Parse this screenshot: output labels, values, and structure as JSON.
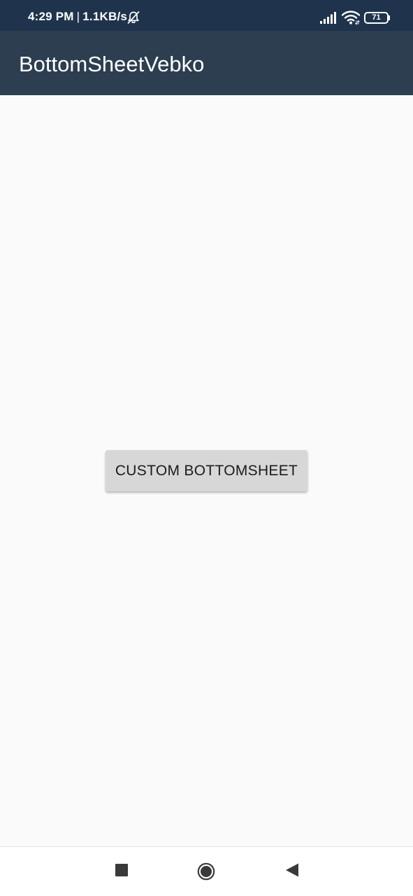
{
  "status_bar": {
    "time": "4:29 PM",
    "separator": "|",
    "network_speed": "1.1KB/s",
    "battery_level": "71",
    "icons": [
      "bell-off-icon",
      "signal-icon",
      "wifi-icon",
      "battery-icon"
    ],
    "background_color": "#1f344c"
  },
  "app_bar": {
    "title": "BottomSheetVebko",
    "background_color": "#2d3e50"
  },
  "main": {
    "button_label": "CUSTOM BOTTOMSHEET"
  },
  "nav_bar": {
    "icons": [
      "recent-apps-icon",
      "home-icon",
      "back-icon"
    ]
  }
}
